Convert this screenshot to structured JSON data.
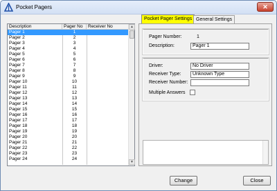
{
  "window": {
    "title": "Pocket Pagers",
    "close_glyph": "✕"
  },
  "list": {
    "columns": [
      "Description",
      "Pager No",
      "Receiver No"
    ],
    "rows": [
      {
        "name": "Pager 1",
        "no": "1"
      },
      {
        "name": "Pager 2",
        "no": "2"
      },
      {
        "name": "Pager 3",
        "no": "3"
      },
      {
        "name": "Pager 4",
        "no": "4"
      },
      {
        "name": "Pager 5",
        "no": "5"
      },
      {
        "name": "Pager 6",
        "no": "6"
      },
      {
        "name": "Pager 7",
        "no": "7"
      },
      {
        "name": "Pager 8",
        "no": "8"
      },
      {
        "name": "Pager 9",
        "no": "9"
      },
      {
        "name": "Pager 10",
        "no": "10"
      },
      {
        "name": "Pager 11",
        "no": "11"
      },
      {
        "name": "Pager 12",
        "no": "12"
      },
      {
        "name": "Pager 13",
        "no": "13"
      },
      {
        "name": "Pager 14",
        "no": "14"
      },
      {
        "name": "Pager 15",
        "no": "15"
      },
      {
        "name": "Pager 16",
        "no": "16"
      },
      {
        "name": "Pager 17",
        "no": "17"
      },
      {
        "name": "Pager 18",
        "no": "18"
      },
      {
        "name": "Pager 19",
        "no": "19"
      },
      {
        "name": "Pager 20",
        "no": "20"
      },
      {
        "name": "Pager 21",
        "no": "21"
      },
      {
        "name": "Pager 22",
        "no": "22"
      },
      {
        "name": "Pager 23",
        "no": "23"
      },
      {
        "name": "Pager 24",
        "no": "24"
      }
    ],
    "selected_index": 0
  },
  "tabs": [
    {
      "label": "Pocket Pager Settings",
      "active": true
    },
    {
      "label": "General Settings",
      "active": false
    }
  ],
  "settings": {
    "pager_number_label": "Pager Number:",
    "pager_number_value": "1",
    "description_label": "Description:",
    "description_value": "Pager 1",
    "driver_label": "Driver:",
    "driver_value": "No Driver",
    "receiver_type_label": "Receiver Type:",
    "receiver_type_value": "Unknown Type",
    "receiver_number_label": "Receiver Number:",
    "receiver_number_value": "",
    "multiple_answers_label": "Multiple Answers",
    "multiple_answers_checked": false
  },
  "buttons": {
    "change": "Change",
    "close": "Close"
  },
  "colors": {
    "active_tab": "#ffff00",
    "selection": "#3399ff"
  }
}
